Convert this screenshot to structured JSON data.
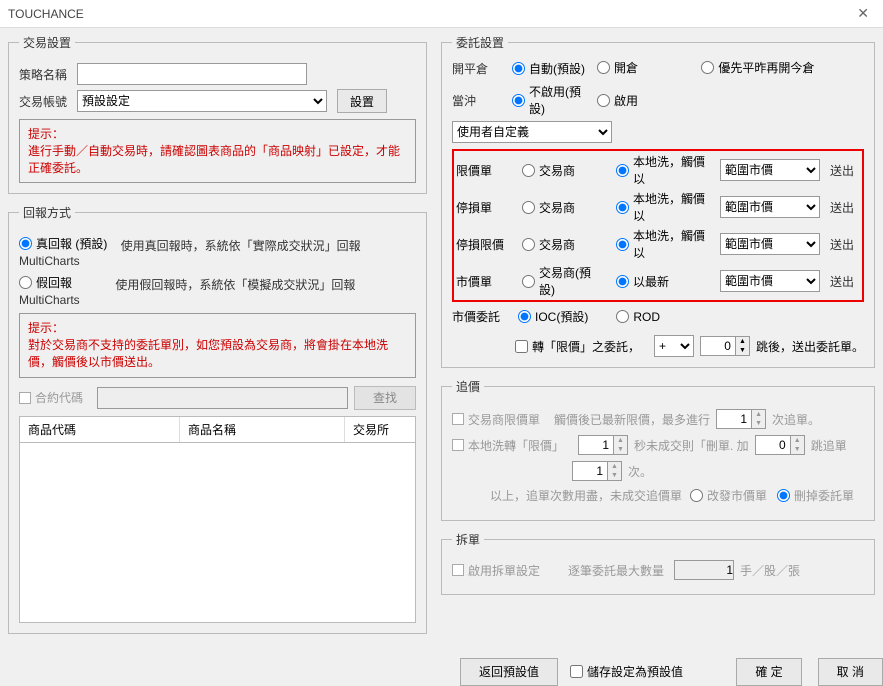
{
  "title": "TOUCHANCE",
  "transSettings": {
    "legend": "交易設置",
    "strategyLabel": "策略名稱",
    "accountLabel": "交易帳號",
    "accountSelected": "預設設定",
    "setBtn": "設置",
    "hintTitle": "提示：",
    "hintText": "進行手動／自動交易時，請確認圖表商品的「商品映射」已設定，才能正確委託。"
  },
  "reportMode": {
    "legend": "回報方式",
    "realLabel": "真回報 (預設)",
    "realDesc": "使用真回報時，系統依「實際成交狀況」回報 MultiCharts",
    "fakeLabel": "假回報",
    "fakeDesc": "使用假回報時，系統依「模擬成交狀況」回報 MultiCharts",
    "hintTitle": "提示：",
    "hintText": "對於交易商不支持的委託單別，如您預設為交易商，將會掛在本地洗價，觸價後以市價送出。",
    "contractLabel": "合約代碼",
    "searchBtn": "查找",
    "th1": "商品代碼",
    "th2": "商品名稱",
    "th3": "交易所"
  },
  "orderSettings": {
    "legend": "委託設置",
    "openCloseLabel": "開平倉",
    "opt_auto": "自動(預設)",
    "opt_open": "開倉",
    "opt_closeFirst": "優先平昨再開今倉",
    "dayTradeLabel": "當沖",
    "opt_disable": "不啟用(預設)",
    "opt_enable": "啟用",
    "customSelected": "使用者自定義",
    "rows": [
      {
        "label": "限價單",
        "broker": "交易商",
        "local": "本地洗，觸價以",
        "sel": "範圍市價",
        "send": "送出"
      },
      {
        "label": "停損單",
        "broker": "交易商",
        "local": "本地洗，觸價以",
        "sel": "範圍市價",
        "send": "送出"
      },
      {
        "label": "停損限價",
        "broker": "交易商",
        "local": "本地洗，觸價以",
        "sel": "範圍市價",
        "send": "送出"
      },
      {
        "label": "市價單",
        "broker": "交易商(預設)",
        "local": "以最新",
        "sel": "範圍市價",
        "send": "送出"
      }
    ],
    "marketOrderLabel": "市價委託",
    "ioc": "IOC(預設)",
    "rod": "ROD",
    "convertCb": "轉「限價」之委託，",
    "plus": "+",
    "zero": "0",
    "convertTail": "跳後，送出委託單。"
  },
  "chase": {
    "legend": "追價",
    "brokerLimit": "交易商限價單",
    "brokerLimitDesc1": "觸價後已最新限價，最多進行",
    "one": "1",
    "times": "次追單。",
    "localLimit": "本地洗轉「限價」",
    "localDesc": "秒未成交則「刪單. 加",
    "zero": "0",
    "jump": "跳追單",
    "times2": "次。",
    "summary": "以上，追單次數用盡，未成交追價單",
    "toMarket": "改發市價單",
    "cancel": "刪掉委託單"
  },
  "split": {
    "legend": "拆單",
    "enable": "啟用拆單設定",
    "maxLabel": "逐筆委託最大數量",
    "one": "1",
    "unit": "手／股／張"
  },
  "footer": {
    "reset": "返回預設值",
    "saveCb": "儲存設定為預設值",
    "ok": "確 定",
    "cancel": "取 消"
  }
}
